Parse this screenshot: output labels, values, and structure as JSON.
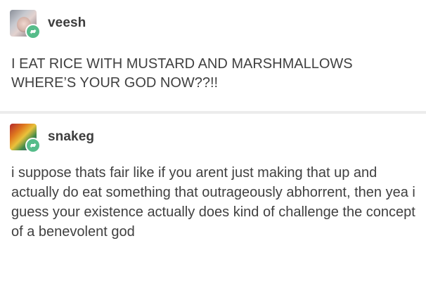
{
  "post1": {
    "username": "veesh",
    "body": "I EAT RICE WITH MUSTARD AND MARSHMALLOWS WHERE’S YOUR GOD NOW??!!"
  },
  "post2": {
    "username": "snakeg",
    "body": "i suppose thats fair like if you arent just making that up and actually do eat something that outrageously abhorrent, then yea i guess your existence actually does kind of challenge the concept of a benevolent god"
  },
  "colors": {
    "reblog_badge": "#56bc8a",
    "background": "#ffffff",
    "text": "#404040"
  },
  "icons": {
    "reblog": "reblog-icon"
  }
}
